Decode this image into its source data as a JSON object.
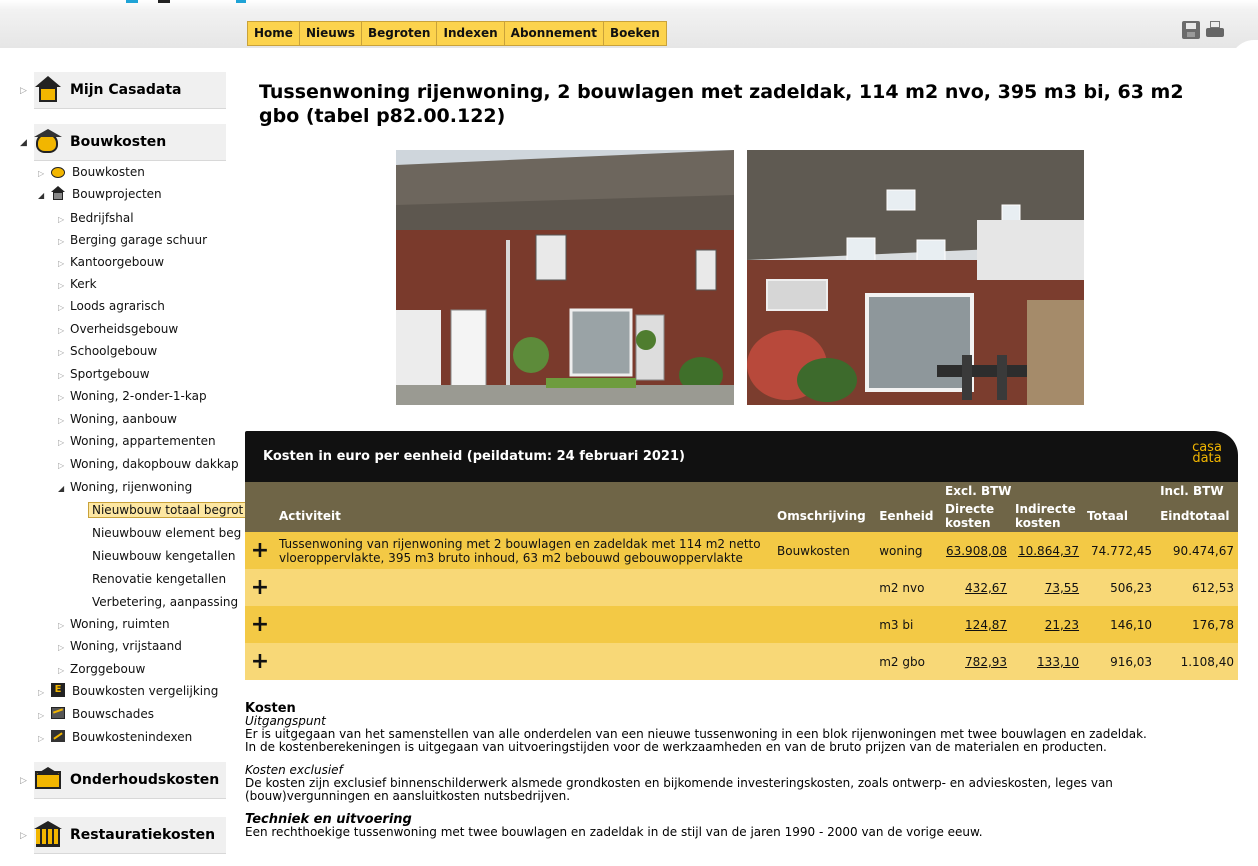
{
  "menu": [
    "Home",
    "Nieuws",
    "Begroten",
    "Indexen",
    "Abonnement",
    "Boeken"
  ],
  "sidebar": {
    "sections": {
      "mijn_casadata": "Mijn Casadata",
      "bouwkosten": "Bouwkosten",
      "onderhoudskosten": "Onderhoudskosten",
      "restauratiekosten": "Restauratiekosten"
    },
    "items": [
      "Bouwkosten",
      "Bouwprojecten",
      "Bedrijfshal",
      "Berging garage schuur",
      "Kantoorgebouw",
      "Kerk",
      "Loods agrarisch",
      "Overheidsgebouw",
      "Schoolgebouw",
      "Sportgebouw",
      "Woning, 2-onder-1-kap",
      "Woning, aanbouw",
      "Woning, appartementen",
      "Woning, dakopbouw dakkap",
      "Woning, rijenwoning",
      "Nieuwbouw totaal begrot",
      "Nieuwbouw element beg",
      "Nieuwbouw kengetallen",
      "Renovatie kengetallen",
      "Verbetering, aanpassing",
      "Woning, ruimten",
      "Woning, vrijstaand",
      "Zorggebouw",
      "Bouwkosten vergelijking",
      "Bouwschades",
      "Bouwkostenindexen"
    ]
  },
  "page": {
    "title": "Tussenwoning rijenwoning, 2 bouwlagen met zadeldak, 114 m2 nvo, 395 m3 bi, 63 m2 gbo (tabel p82.00.122)"
  },
  "costs": {
    "heading": "Kosten in euro per eenheid (peildatum: 24 februari 2021)",
    "logo": [
      "casa",
      "data"
    ],
    "group_excl": "Excl. BTW",
    "group_incl": "Incl. BTW",
    "columns": [
      "Activiteit",
      "Omschrijving",
      "Eenheid",
      "Directe kosten",
      "Indirecte kosten",
      "Totaal",
      "Eindtotaal"
    ],
    "rows": [
      {
        "activiteit": "Tussenwoning van rijenwoning met 2 bouwlagen en zadeldak met 114 m2 netto vloeroppervlakte, 395 m3 bruto inhoud, 63 m2 bebouwd gebouwoppervlakte",
        "omschrijving": "Bouwkosten",
        "eenheid": "woning",
        "directe": "63.908,08",
        "indirecte": "10.864,37",
        "totaal": "74.772,45",
        "eindtotaal": "90.474,67"
      },
      {
        "activiteit": "",
        "omschrijving": "",
        "eenheid": "m2 nvo",
        "directe": "432,67",
        "indirecte": "73,55",
        "totaal": "506,23",
        "eindtotaal": "612,53"
      },
      {
        "activiteit": "",
        "omschrijving": "",
        "eenheid": "m3 bi",
        "directe": "124,87",
        "indirecte": "21,23",
        "totaal": "146,10",
        "eindtotaal": "176,78"
      },
      {
        "activiteit": "",
        "omschrijving": "",
        "eenheid": "m2 gbo",
        "directe": "782,93",
        "indirecte": "133,10",
        "totaal": "916,03",
        "eindtotaal": "1.108,40"
      }
    ]
  },
  "desc": {
    "kosten": "Kosten",
    "uitgangspunt": "Uitgangspunt",
    "p1": "Er is uitgegaan van het samenstellen van alle onderdelen van een nieuwe tussenwoning in een blok rijenwoningen met twee bouwlagen en zadeldak.",
    "p2": "In de kostenberekeningen is uitgegaan van uitvoeringstijden voor de werkzaamheden en van de bruto prijzen van de materialen en producten.",
    "exclusief": "Kosten exclusief",
    "p3": "De kosten zijn exclusief binnenschilderwerk alsmede grondkosten en bijkomende investeringskosten, zoals ontwerp- en advieskosten, leges van",
    "p4": "(bouw)vergunningen en aansluitkosten nutsbedrijven.",
    "techniek": "Techniek en uitvoering",
    "p5": "Een rechthoekige tussenwoning met twee bouwlagen en zadeldak in de stijl van de jaren 1990 - 2000 van de vorige eeuw."
  }
}
